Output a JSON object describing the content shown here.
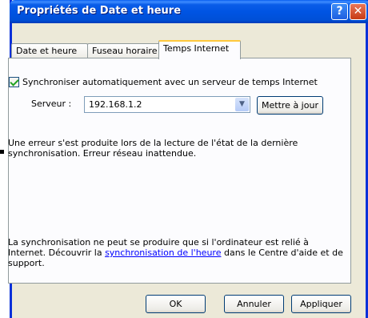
{
  "window": {
    "title": "Propriétés de Date et heure",
    "help_glyph": "?",
    "close_glyph": "✕"
  },
  "tabs": [
    {
      "label": "Date et heure",
      "active": false
    },
    {
      "label": "Fuseau horaire",
      "active": false
    },
    {
      "label": "Temps Internet",
      "active": true
    }
  ],
  "sync": {
    "checkbox_label": "Synchroniser automatiquement avec un serveur de temps Internet",
    "checked": true
  },
  "server": {
    "label": "Serveur :",
    "value": "192.168.1.2",
    "update_button": "Mettre à jour"
  },
  "messages": {
    "error": "Une erreur s'est produite lors de la lecture de l'état de la dernière synchronisation. Erreur réseau inattendue.",
    "info_prefix": "La synchronisation ne peut se produire que si l'ordinateur est relié à Internet. Découvrir la ",
    "info_link": "synchronisation de l'heure",
    "info_suffix": " dans le Centre d'aide et de support."
  },
  "buttons": {
    "ok": "OK",
    "cancel": "Annuler",
    "apply": "Appliquer"
  },
  "colors": {
    "titlebar": "#0054e3",
    "dialog_bg": "#ece9d8",
    "active_tab_accent": "#ffc83c",
    "link": "#0000ff"
  },
  "icons": {
    "help": "help-icon",
    "close": "close-icon",
    "dropdown": "chevron-down-icon",
    "check": "checkmark-icon"
  }
}
